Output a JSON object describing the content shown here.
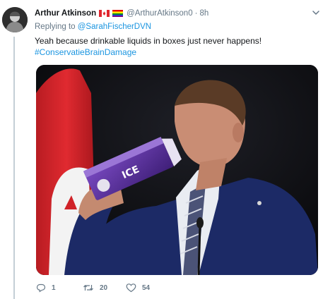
{
  "author": {
    "display_name": "Arthur Atkinson",
    "handle": "@ArthurAtkinson0",
    "time": "8h",
    "flags": [
      "canada-flag-icon",
      "rainbow-flag-icon"
    ]
  },
  "reply": {
    "prefix": "Replying to",
    "target": "@SarahFischerDVN"
  },
  "tweet": {
    "text": "Yeah because drinkable liquids in boxes just never happens!",
    "hashtag": "#ConservatieBrainDamage"
  },
  "actions": {
    "reply_count": "1",
    "retweet_count": "20",
    "like_count": "54"
  },
  "media": {
    "carton_text": "ICE"
  },
  "colors": {
    "link": "#1b95e0",
    "muted": "#657786",
    "thread_line": "#c4cfd6",
    "suit": "#1c2a66",
    "carton": "#5a2d91"
  }
}
